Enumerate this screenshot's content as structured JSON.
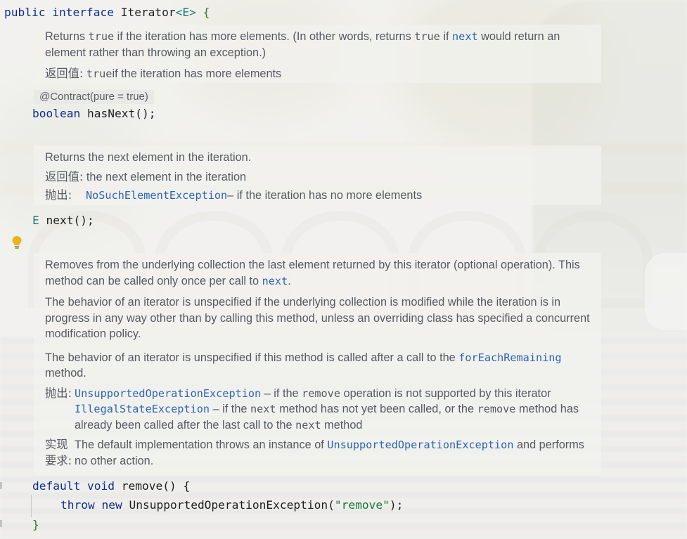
{
  "header": {
    "kw_public": "public",
    "kw_interface": "interface",
    "name": "Iterator",
    "generic": "<E>",
    "brace": "{"
  },
  "hasNext": {
    "doc": {
      "line1_a": "Returns ",
      "line1_code": "true",
      "line1_b": " if the iteration has more elements. (In other words, returns ",
      "line1_code2": "true",
      "line1_c": " if ",
      "line1_link": "next",
      "line1_d": " would return an element rather than throwing an exception.)",
      "returns_label": "返回值:",
      "returns_code": "true",
      "returns_text": " if the iteration has more elements"
    },
    "annotation": "@Contract(pure = true)",
    "sig_type": "boolean",
    "sig_name": "hasNext",
    "sig_parens": "();"
  },
  "next": {
    "doc": {
      "line1": "Returns the next element in the iteration.",
      "returns_label": "返回值:",
      "returns_text": "the next element in the iteration",
      "throws_label": "抛出:",
      "throws_link": "NoSuchElementException",
      "throws_text": " – if the iteration has no more elements"
    },
    "sig_type": "E",
    "sig_name": "next",
    "sig_parens": "();"
  },
  "remove": {
    "doc": {
      "p1_a": "Removes from the underlying collection the last element returned by this iterator (optional operation). This method can be called only once per call to ",
      "p1_link": "next",
      "p1_b": ".",
      "p2": "The behavior of an iterator is unspecified if the underlying collection is modified while the iteration is in progress in any way other than by calling this method, unless an overriding class has specified a concurrent modification policy.",
      "p3_a": "The behavior of an iterator is unspecified if this method is called after a call to the ",
      "p3_link": "forEachRemaining",
      "p3_b": " method.",
      "throws_label": "抛出:",
      "t1_link": "UnsupportedOperationException",
      "t1_a": " – if the ",
      "t1_code": "remove",
      "t1_b": " operation is not supported by this iterator",
      "t2_link": "IllegalStateException",
      "t2_a": " – if the ",
      "t2_code": "next",
      "t2_b": " method has not yet been called, or the ",
      "t2_code2": "remove",
      "t2_c": " method has already been called after the last call to the ",
      "t2_code3": "next",
      "t2_d": " method",
      "impl_label_1": "实现",
      "impl_label_2": "要求:",
      "impl_a": "The default implementation throws an instance of ",
      "impl_link": "UnsupportedOperationException",
      "impl_b": " and performs no other action."
    },
    "kw_default": "default",
    "kw_void": "void",
    "sig_name": "remove",
    "sig_tail": "() {",
    "kw_throw": "throw",
    "kw_new": "new",
    "exc_name": "UnsupportedOperationException",
    "open_paren": "(",
    "str": "\"remove\"",
    "close": ");",
    "close_brace": "}"
  },
  "colors": {
    "keyword": "#0d2e8f",
    "link": "#2d64b5",
    "string": "#16763a",
    "generic": "#1d7b7b"
  },
  "icons": {
    "intention": "lightbulb-icon"
  }
}
